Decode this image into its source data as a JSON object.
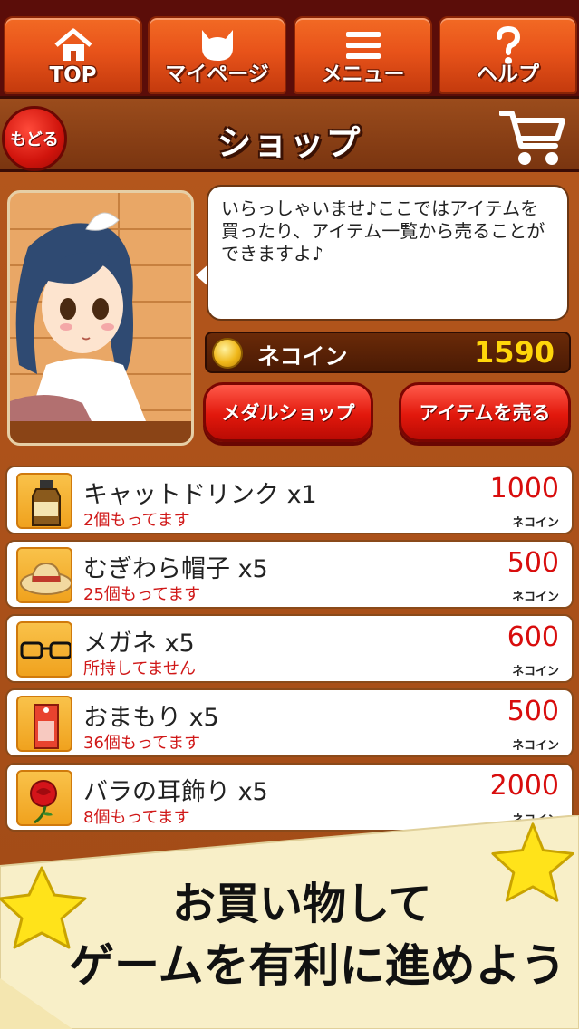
{
  "nav": {
    "top": "TOP",
    "mypage": "マイページ",
    "menu": "メニュー",
    "help": "ヘルプ"
  },
  "header": {
    "back": "もどる",
    "title": "ショップ"
  },
  "speech": "いらっしゃいませ♪ここではアイテムを買ったり、アイテム一覧から売ることができますよ♪",
  "coins": {
    "label": "ネコイン",
    "value": "1590"
  },
  "buttons": {
    "medal_shop": "メダルショップ",
    "sell_items": "アイテムを売る"
  },
  "items": [
    {
      "name": "キャットドリンク x1",
      "owned": "2個もってます",
      "price": "1000",
      "unit": "ネコイン",
      "icon": "bottle-icon"
    },
    {
      "name": "むぎわら帽子 x5",
      "owned": "25個もってます",
      "price": "500",
      "unit": "ネコイン",
      "icon": "straw-hat-icon"
    },
    {
      "name": "メガネ x5",
      "owned": "所持してません",
      "price": "600",
      "unit": "ネコイン",
      "icon": "glasses-icon"
    },
    {
      "name": "おまもり x5",
      "owned": "36個もってます",
      "price": "500",
      "unit": "ネコイン",
      "icon": "amulet-icon"
    },
    {
      "name": "バラの耳飾り x5",
      "owned": "8個もってます",
      "price": "2000",
      "unit": "ネコイン",
      "icon": "rose-earring-icon"
    }
  ],
  "banner": {
    "line1": "お買い物して",
    "line2": "ゲームを有利に進めよう"
  },
  "colors": {
    "nav_orange": "#e8531a",
    "header_brown": "#8a3f14",
    "panel_brown": "#a84e18",
    "price_red": "#d80d0d",
    "coin_yellow": "#ffd60a",
    "banner_cream": "#f8efc8"
  }
}
